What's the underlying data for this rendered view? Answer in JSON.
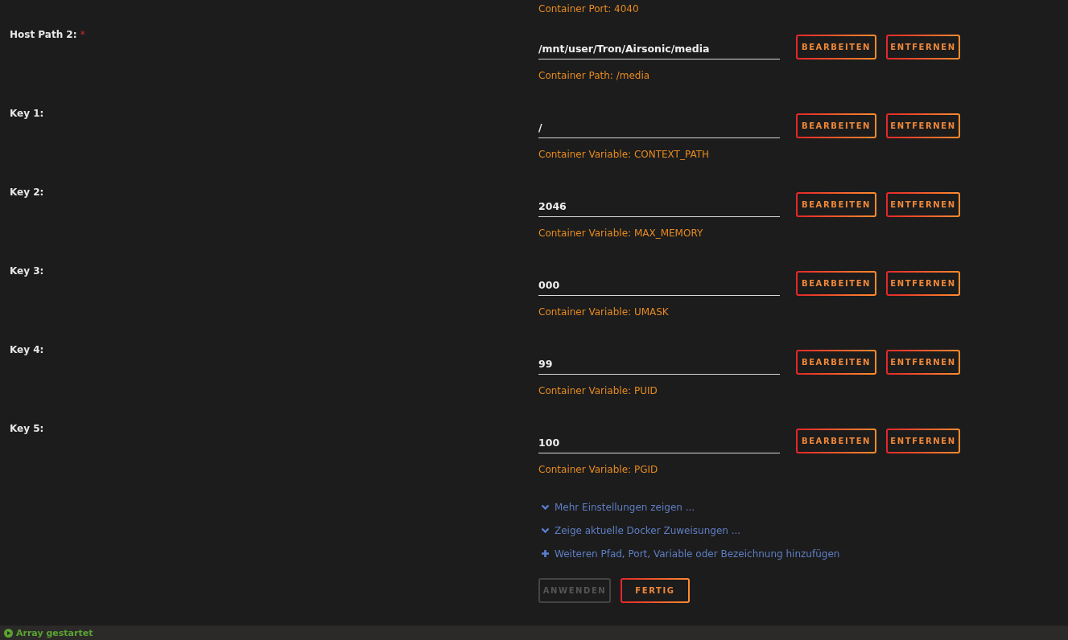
{
  "top_hint": "Container Port: 4040",
  "fields": [
    {
      "label": "Host Path 2:",
      "required_mark": "*",
      "value": "/mnt/user/Tron/Airsonic/media",
      "hint": "Container Path: /media",
      "actions": [
        {
          "label": "BEARBEITEN"
        },
        {
          "label": "ENTFERNEN"
        }
      ]
    },
    {
      "label": "Key 1:",
      "value": "/",
      "hint": "Container Variable: CONTEXT_PATH",
      "actions": [
        {
          "label": "BEARBEITEN"
        },
        {
          "label": "ENTFERNEN"
        }
      ]
    },
    {
      "label": "Key 2:",
      "value": "2046",
      "hint": "Container Variable: MAX_MEMORY",
      "actions": [
        {
          "label": "BEARBEITEN"
        },
        {
          "label": "ENTFERNEN"
        }
      ]
    },
    {
      "label": "Key 3:",
      "value": "000",
      "hint": "Container Variable: UMASK",
      "actions": [
        {
          "label": "BEARBEITEN"
        },
        {
          "label": "ENTFERNEN"
        }
      ]
    },
    {
      "label": "Key 4:",
      "value": "99",
      "hint": "Container Variable: PUID",
      "actions": [
        {
          "label": "BEARBEITEN"
        },
        {
          "label": "ENTFERNEN"
        }
      ]
    },
    {
      "label": "Key 5:",
      "value": "100",
      "hint": "Container Variable: PGID",
      "actions": [
        {
          "label": "BEARBEITEN"
        },
        {
          "label": "ENTFERNEN"
        }
      ]
    }
  ],
  "links": [
    {
      "kind": "expand",
      "label": "Mehr Einstellungen zeigen ..."
    },
    {
      "kind": "expand",
      "label": "Zeige aktuelle Docker Zuweisungen ..."
    },
    {
      "kind": "add",
      "label": "Weiteren Pfad, Port, Variable oder Bezeichnung hinzufügen"
    }
  ],
  "buttons": [
    {
      "label": "ANWENDEN",
      "disabled": true
    },
    {
      "label": "FERTIG",
      "disabled": false
    }
  ],
  "status_bar": {
    "text": "Array gestartet"
  }
}
